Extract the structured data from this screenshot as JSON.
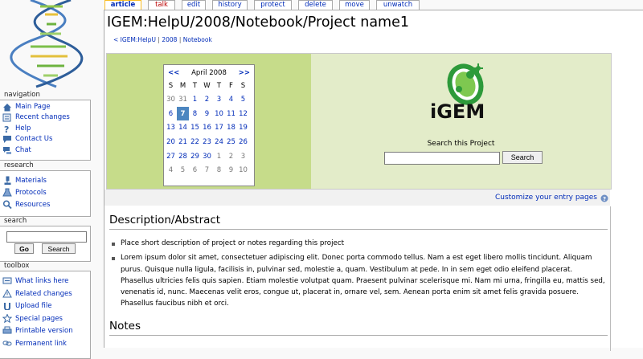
{
  "tabs": [
    {
      "label": "article"
    },
    {
      "label": "talk"
    },
    {
      "label": "edit"
    },
    {
      "label": "history"
    },
    {
      "label": "protect"
    },
    {
      "label": "delete"
    },
    {
      "label": "move"
    },
    {
      "label": "unwatch"
    }
  ],
  "page": {
    "title": "IGEM:HelpU/2008/Notebook/Project name1",
    "breadcrumb": [
      "< IGEM:HelpU",
      "2008",
      "Notebook"
    ],
    "breadcrumb_sep": "|"
  },
  "sidebar": {
    "navigation": {
      "title": "navigation",
      "items": [
        {
          "label": "Main Page",
          "icon": "house-icon"
        },
        {
          "label": "Recent changes",
          "icon": "list-icon"
        },
        {
          "label": "Help",
          "icon": "question-icon"
        },
        {
          "label": "Contact Us",
          "icon": "speech-bubble-icon"
        },
        {
          "label": "Chat",
          "icon": "chat-icon"
        }
      ]
    },
    "research": {
      "title": "research",
      "items": [
        {
          "label": "Materials",
          "icon": "microscope-icon"
        },
        {
          "label": "Protocols",
          "icon": "flask-icon"
        },
        {
          "label": "Resources",
          "icon": "magnifier-icon"
        }
      ]
    },
    "search": {
      "title": "search",
      "go_label": "Go",
      "search_label": "Search",
      "value": ""
    },
    "toolbox": {
      "title": "toolbox",
      "items": [
        {
          "label": "What links here",
          "icon": "links-icon"
        },
        {
          "label": "Related changes",
          "icon": "warning-icon"
        },
        {
          "label": "Upload file",
          "icon": "upload-icon"
        },
        {
          "label": "Special pages",
          "icon": "star-icon"
        },
        {
          "label": "Printable version",
          "icon": "printer-icon"
        },
        {
          "label": "Permanent link",
          "icon": "link-icon"
        }
      ]
    }
  },
  "calendar": {
    "month": "April 2008",
    "prev": "<<",
    "next": ">>",
    "weekdays": [
      "S",
      "M",
      "T",
      "W",
      "T",
      "F",
      "S"
    ],
    "weeks": [
      [
        "30",
        "31",
        "1",
        "2",
        "3",
        "4",
        "5"
      ],
      [
        "6",
        "7",
        "8",
        "9",
        "10",
        "11",
        "12"
      ],
      [
        "13",
        "14",
        "15",
        "16",
        "17",
        "18",
        "19"
      ],
      [
        "20",
        "21",
        "22",
        "23",
        "24",
        "25",
        "26"
      ],
      [
        "27",
        "28",
        "29",
        "30",
        "1",
        "2",
        "3"
      ],
      [
        "4",
        "5",
        "6",
        "7",
        "8",
        "9",
        "10"
      ]
    ],
    "other_month": [
      [
        0,
        0
      ],
      [
        0,
        1
      ],
      [
        4,
        4
      ],
      [
        4,
        5
      ],
      [
        4,
        6
      ],
      [
        5,
        0
      ],
      [
        5,
        1
      ],
      [
        5,
        2
      ],
      [
        5,
        3
      ],
      [
        5,
        4
      ],
      [
        5,
        5
      ],
      [
        5,
        6
      ]
    ],
    "today": [
      1,
      1
    ]
  },
  "project_search": {
    "label": "Search this Project",
    "button": "Search",
    "value": ""
  },
  "logo": {
    "text": "iGEM",
    "accent": "#2d9a3a"
  },
  "customize": {
    "label": "Customize your entry pages"
  },
  "sections": {
    "description_title": "Description/Abstract",
    "notes_title": "Notes",
    "bullets": [
      "Place short description of project or notes regarding this project",
      "Lorem ipsum dolor sit amet, consectetuer adipiscing elit. Donec porta commodo tellus. Nam a est eget libero mollis tincidunt. Aliquam purus. Quisque nulla ligula, facilisis in, pulvinar sed, molestie a, quam. Vestibulum at pede. In in sem eget odio eleifend placerat. Phasellus ultricies felis quis sapien. Etiam molestie volutpat quam. Praesent pulvinar scelerisque mi. Nam mi urna, fringilla eu, mattis sed, venenatis id, nunc. Maecenas velit eros, congue ut, placerat in, ornare vel, sem. Aenean porta enim sit amet felis gravida posuere. Phasellus faucibus nibh et orci."
    ]
  },
  "colors": {
    "link": "#002bb8",
    "calendar_left_bg": "#c6dc8a",
    "calendar_right_bg": "#e3ecc9",
    "today_bg": "#4c86c0",
    "selected_tab_border": "#fabd23"
  }
}
